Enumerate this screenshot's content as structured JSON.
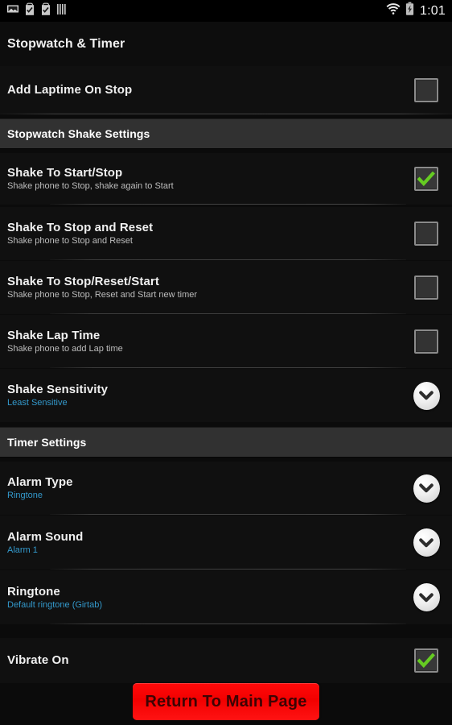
{
  "statusbar": {
    "time": "1:01",
    "left_icons": [
      "image-icon",
      "clipboard-check-icon",
      "clipboard-check-icon",
      "vertical-bars-icon"
    ],
    "right_icons": [
      "wifi-icon",
      "battery-charging-icon"
    ]
  },
  "header": {
    "title": "Stopwatch & Timer"
  },
  "colors": {
    "accent_link": "#3399cc",
    "check_green": "#66cc22",
    "button_red": "#f20000",
    "section_bg": "#313131",
    "page_bg": "#101010"
  },
  "rows": {
    "add_laptime": {
      "title": "Add Laptime On Stop",
      "widget": "checkbox",
      "checked": false
    },
    "shake_start_stop": {
      "title": "Shake To Start/Stop",
      "subtitle": "Shake phone to Stop, shake again to Start",
      "widget": "checkbox",
      "checked": true
    },
    "shake_stop_reset": {
      "title": "Shake To Stop and Reset",
      "subtitle": "Shake phone to Stop and Reset",
      "widget": "checkbox",
      "checked": false
    },
    "shake_stop_reset_start": {
      "title": "Shake To Stop/Reset/Start",
      "subtitle": "Shake phone to Stop, Reset and Start new timer",
      "widget": "checkbox",
      "checked": false
    },
    "shake_lap_time": {
      "title": "Shake Lap Time",
      "subtitle": "Shake phone to add Lap time",
      "widget": "checkbox",
      "checked": false
    },
    "shake_sensitivity": {
      "title": "Shake Sensitivity",
      "value": "Least Sensitive",
      "widget": "dropdown"
    },
    "alarm_type": {
      "title": "Alarm Type",
      "value": "Ringtone",
      "widget": "dropdown"
    },
    "alarm_sound": {
      "title": "Alarm Sound",
      "value": "Alarm 1",
      "widget": "dropdown"
    },
    "ringtone": {
      "title": "Ringtone",
      "value": "Default ringtone (Girtab)",
      "widget": "dropdown"
    },
    "vibrate_on": {
      "title": "Vibrate On",
      "widget": "checkbox",
      "checked": true
    }
  },
  "sections": {
    "shake_settings": "Stopwatch Shake Settings",
    "timer_settings": "Timer Settings"
  },
  "footer": {
    "return_label": "Return To Main Page"
  }
}
